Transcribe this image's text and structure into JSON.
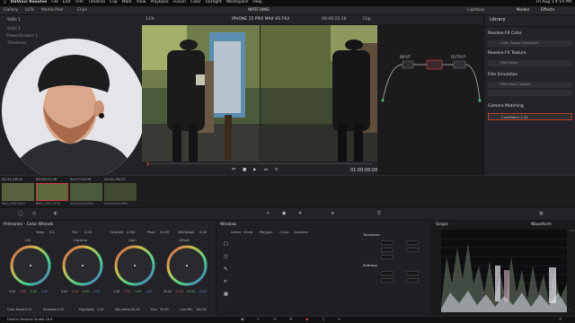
{
  "menubar": {
    "app": "DaVinci Resolve",
    "items": [
      "File",
      "Edit",
      "Trim",
      "Timeline",
      "Clip",
      "Mark",
      "View",
      "Playback",
      "Fusion",
      "Color",
      "Fairlight",
      "Workspace",
      "Help"
    ],
    "clock": "Fri Aug 3 4:19 PM"
  },
  "toolbar": {
    "left_items": [
      "Gallery",
      "LUTs",
      "Media Pool",
      "Clips"
    ],
    "project_title": "WATCHING",
    "right_items": [
      "Lightbox",
      "Nodes",
      "Effects"
    ]
  },
  "mediapool": {
    "heading": "Stills 1",
    "items": [
      "Stills 1",
      "PowerGrades 1",
      "Timelines"
    ]
  },
  "viewer": {
    "zoom": "11%",
    "title": "IPHONE 15 PRO MAX VS FX3",
    "timecode_top": "00:00:22:18",
    "mode_label": "Clip",
    "timecode": "01:00:00:00"
  },
  "nodes": {
    "input_label": "INPUT",
    "output_label": "OUTPUT"
  },
  "library": {
    "title": "Library",
    "sections": [
      {
        "heading": "Resolve FX Color",
        "item": "Color Space Transform"
      },
      {
        "heading": "Resolve FX Texture",
        "item": "Film Grain"
      },
      {
        "heading": "Film Emulation",
        "item": "Film Look Creator"
      },
      {
        "heading": "Camera Matching",
        "item": "CineMatch 1.20"
      }
    ]
  },
  "clips": [
    {
      "timecode": "02:41:28:04",
      "label": "V1",
      "name": "IMG_0382.MOV"
    },
    {
      "timecode": "00:00:22:18",
      "label": "V1",
      "name": "BMG_0001.MOV"
    },
    {
      "timecode": "04:17:23:09",
      "label": "V1",
      "name": "A001C003.MOV"
    },
    {
      "timecode": "00:00:38:23",
      "label": "V1",
      "name": "A002C004.MOV"
    }
  ],
  "wheels": {
    "title": "Primaries - Color Wheels",
    "params": [
      {
        "label": "Temp",
        "value": "0.0"
      },
      {
        "label": "Tint",
        "value": "0.00"
      },
      {
        "label": "Contrast",
        "value": "1.000"
      },
      {
        "label": "Pivot",
        "value": "0.435"
      },
      {
        "label": "Mid/Detail",
        "value": "0.00"
      }
    ],
    "items": [
      {
        "name": "Lift",
        "values": [
          "0.00",
          "0.00",
          "0.00",
          "0.00"
        ]
      },
      {
        "name": "Gamma",
        "values": [
          "0.00",
          "0.00",
          "0.00",
          "0.00"
        ]
      },
      {
        "name": "Gain",
        "values": [
          "1.00",
          "1.00",
          "1.00",
          "1.00"
        ]
      },
      {
        "name": "Offset",
        "values": [
          "25.00",
          "25.00",
          "25.00",
          "25.00"
        ]
      }
    ],
    "bottom_params": [
      {
        "label": "Color Boost",
        "value": "0.00"
      },
      {
        "label": "Shadows",
        "value": "0.00"
      },
      {
        "label": "Highlights",
        "value": "0.00"
      },
      {
        "label": "Saturation",
        "value": "50.00"
      },
      {
        "label": "Hue",
        "value": "50.00"
      },
      {
        "label": "Lum Mix",
        "value": "100.00"
      }
    ]
  },
  "window": {
    "title": "Window",
    "shapes": [
      "Linear",
      "Circle",
      "Polygon",
      "Curve",
      "Gradient"
    ],
    "transform_title": "Transform",
    "softness_title": "Softness"
  },
  "scope": {
    "title": "Scope",
    "mode": "Waveform",
    "scale": [
      "1023",
      "896",
      "768",
      "640",
      "512",
      "384",
      "256",
      "128",
      "0"
    ]
  },
  "pagebar": {
    "app": "DaVinci Resolve Studio 18.6"
  },
  "colors": {
    "accent_red": "#c33a3a",
    "selection_orange": "#b8442d"
  }
}
